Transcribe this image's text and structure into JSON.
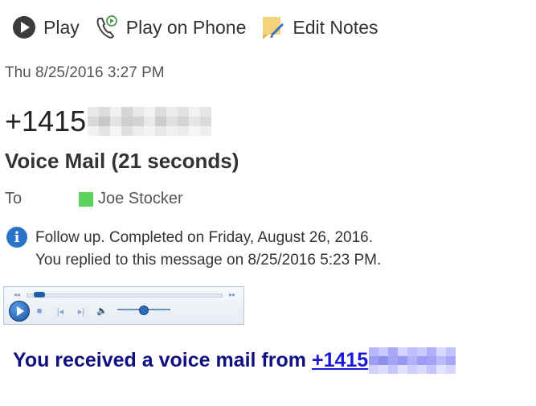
{
  "toolbar": {
    "play_label": "Play",
    "play_on_phone_label": "Play on Phone",
    "edit_notes_label": "Edit Notes"
  },
  "message": {
    "date": "Thu 8/25/2016 3:27 PM",
    "from_prefix": "+1415",
    "subject": "Voice Mail (21 seconds)",
    "to_label": "To",
    "to_name": "Joe Stocker",
    "presence_color": "#5bd35b",
    "info_line1": "Follow up.  Completed on Friday, August 26, 2016.",
    "info_line2": "You replied to this message on 8/25/2016 5:23 PM."
  },
  "player": {
    "position": 0.03,
    "volume": 0.5
  },
  "body": {
    "received_text": "You received a voice mail from",
    "number_prefix": "+1415"
  }
}
